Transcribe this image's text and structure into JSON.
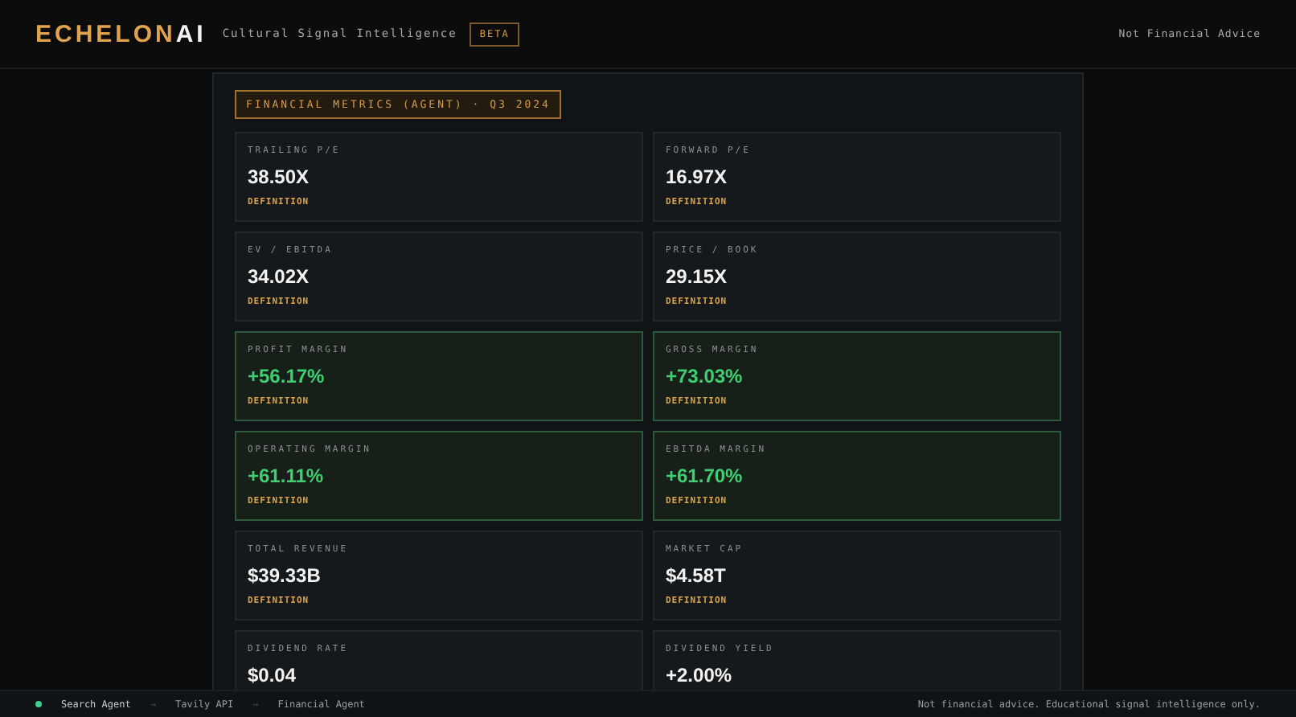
{
  "header": {
    "logo_primary": "ECHELON",
    "logo_accent": "AI",
    "tagline": "Cultural Signal Intelligence",
    "badge": "BETA",
    "notice": "Not Financial Advice"
  },
  "panel": {
    "title": "FINANCIAL METRICS (AGENT) · Q3 2024",
    "metrics": [
      {
        "label": "TRAILING P/E",
        "value": "38.50X",
        "kind": "neutral",
        "definition": "DEFINITION"
      },
      {
        "label": "FORWARD P/E",
        "value": "16.97X",
        "kind": "neutral",
        "definition": "DEFINITION"
      },
      {
        "label": "EV / EBITDA",
        "value": "34.02X",
        "kind": "neutral",
        "definition": "DEFINITION"
      },
      {
        "label": "PRICE / BOOK",
        "value": "29.15X",
        "kind": "neutral",
        "definition": "DEFINITION"
      },
      {
        "label": "PROFIT MARGIN",
        "value": "+56.17%",
        "kind": "positive",
        "definition": "DEFINITION"
      },
      {
        "label": "GROSS MARGIN",
        "value": "+73.03%",
        "kind": "positive",
        "definition": "DEFINITION"
      },
      {
        "label": "OPERATING MARGIN",
        "value": "+61.11%",
        "kind": "positive",
        "definition": "DEFINITION"
      },
      {
        "label": "EBITDA MARGIN",
        "value": "+61.70%",
        "kind": "positive",
        "definition": "DEFINITION"
      },
      {
        "label": "TOTAL REVENUE",
        "value": "$39.33B",
        "kind": "neutral",
        "definition": "DEFINITION"
      },
      {
        "label": "MARKET CAP",
        "value": "$4.58T",
        "kind": "neutral",
        "definition": "DEFINITION"
      },
      {
        "label": "DIVIDEND RATE",
        "value": "$0.04",
        "kind": "neutral"
      },
      {
        "label": "DIVIDEND YIELD",
        "value": "+2.00%",
        "kind": "neutral"
      }
    ]
  },
  "status_bar": {
    "steps": [
      {
        "label": "Search Agent",
        "active": true
      },
      {
        "label": "Tavily API",
        "active": false
      },
      {
        "label": "Financial Agent",
        "active": false
      }
    ],
    "separator": "→",
    "disclaimer": "Not financial advice. Educational signal intelligence only."
  }
}
